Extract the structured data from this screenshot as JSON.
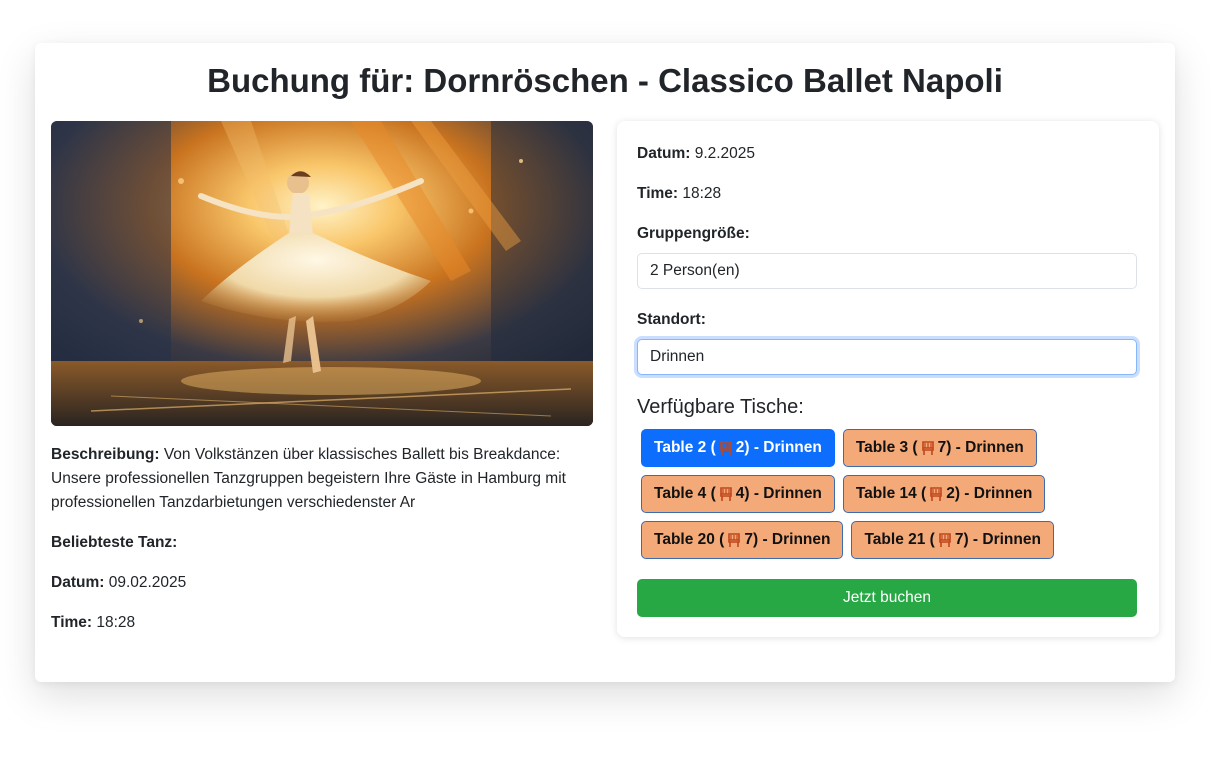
{
  "page": {
    "title": "Buchung für: Dornröschen - Classico Ballet Napoli"
  },
  "left": {
    "image_alt": "ballet dancer painting",
    "description_label": "Beschreibung:",
    "description_text": "Von Volkstänzen über klassisches Ballett bis Breakdance: Unsere professionellen Tanzgruppen begeistern Ihre Gäste in Hamburg mit professionellen Tanzdarbietungen verschiedenster Ar",
    "popular_label": "Beliebteste Tanz:",
    "date_label": "Datum:",
    "date_value": "09.02.2025",
    "time_label": "Time:",
    "time_value": "18:28"
  },
  "booking": {
    "date_label": "Datum:",
    "date_value": "9.2.2025",
    "time_label": "Time:",
    "time_value": "18:28",
    "group_label": "Gruppengröße:",
    "group_value": "2 Person(en)",
    "location_label": "Standort:",
    "location_value": "Drinnen",
    "tables_heading": "Verfügbare Tische:",
    "tables": [
      {
        "prefix": "Table 2 (",
        "suffix": "2) - Drinnen",
        "selected": true
      },
      {
        "prefix": "Table 3 (",
        "suffix": "7) - Drinnen",
        "selected": false
      },
      {
        "prefix": "Table 4 (",
        "suffix": "4) - Drinnen",
        "selected": false
      },
      {
        "prefix": "Table 14 (",
        "suffix": "2) - Drinnen",
        "selected": false
      },
      {
        "prefix": "Table 20 (",
        "suffix": "7) - Drinnen",
        "selected": false
      },
      {
        "prefix": "Table 21 (",
        "suffix": "7) - Drinnen",
        "selected": false
      }
    ],
    "chair_icon": "chair-icon",
    "book_button": "Jetzt buchen"
  },
  "colors": {
    "selected_table": "#0d6efd",
    "table": "#f4a978",
    "book_button": "#28a745",
    "chair": "#c0461b"
  }
}
